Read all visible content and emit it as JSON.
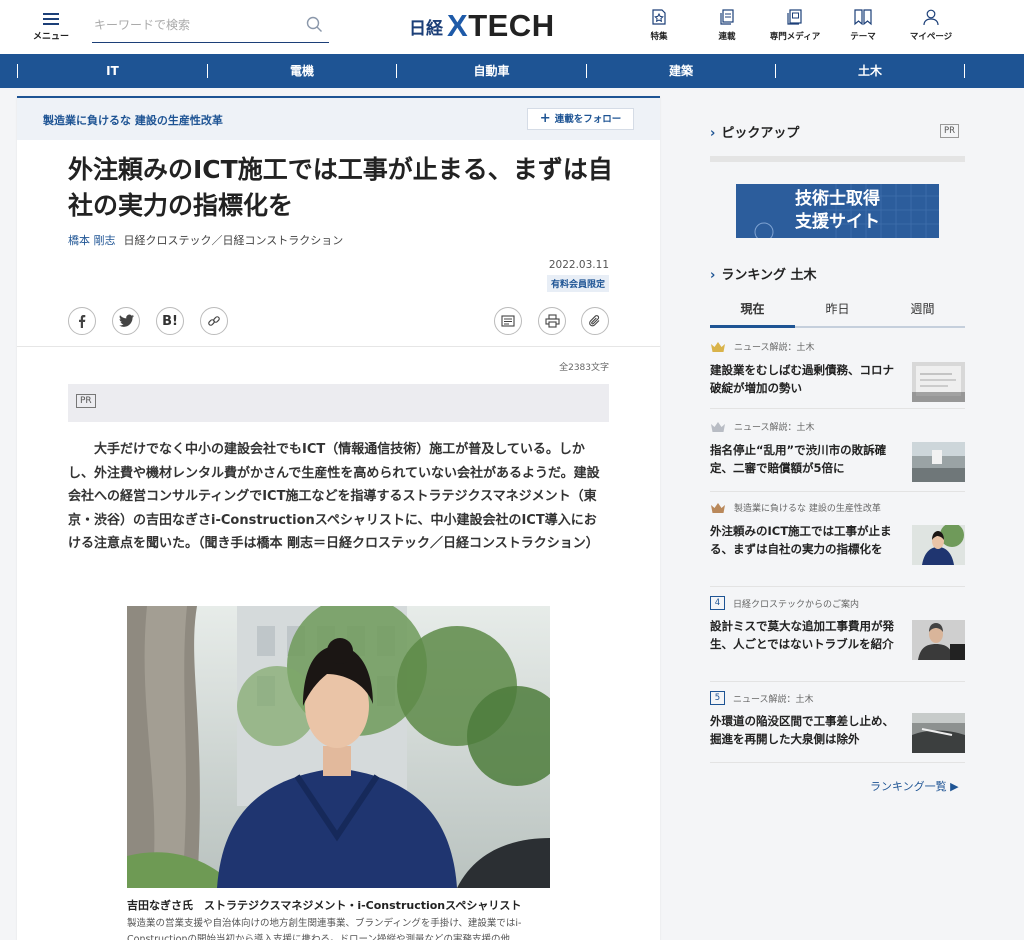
{
  "header": {
    "menu_label": "メニュー",
    "search_placeholder": "キーワードで検索",
    "logo_nikkei": "日経",
    "logo_xtech_x": "X",
    "logo_xtech_rest": "TECH",
    "nav": [
      {
        "label": "特集",
        "icon": "star-document-icon"
      },
      {
        "label": "連載",
        "icon": "stacked-pages-icon"
      },
      {
        "label": "専門メディア",
        "icon": "magazine-icon"
      },
      {
        "label": "テーマ",
        "icon": "bookmark-pair-icon"
      },
      {
        "label": "マイページ",
        "icon": "user-icon"
      }
    ]
  },
  "categories": [
    "IT",
    "電機",
    "自動車",
    "建築",
    "土木"
  ],
  "article": {
    "series_title": "製造業に負けるな 建設の生産性改革",
    "follow_label": "連載をフォロー",
    "headline": "外注頼みのICT施工では工事が止まる、まずは自社の実力の指標化を",
    "author": "橋本 剛志",
    "publication": "日経クロステック／日経コンストラクション",
    "date": "2022.03.11",
    "badge": "有料会員限定",
    "word_count": "全2383文字",
    "pr_label": "PR",
    "lede": "大手だけでなく中小の建設会社でもICT（情報通信技術）施工が普及している。しかし、外注費や機材レンタル費がかさんで生産性を高められていない会社があるようだ。建設会社への経営コンサルティングでICT施工などを指導するストラテジクスマネジメント（東京・渋谷）の吉田なぎさi-Constructionスペシャリストに、中小建設会社のICT導入における注意点を聞いた。（聞き手は橋本 剛志＝日経クロステック／日経コンストラクション）",
    "photo_caption_name": "吉田なぎさ氏　ストラテジクスマネジメント・i-Constructionスペシャリスト",
    "photo_caption_desc": "製造業の営業支援や自治体向けの地方創生関連事業、ブランディングを手掛け、建設業ではi-Constructionの開始当初から導入支援に携わる。ドローン操縦や測量などの実務支援の他"
  },
  "sidebar": {
    "pickup_title": "ピックアップ",
    "pr_label": "PR",
    "banner_line1": "技術士取得",
    "banner_line2": "支援サイト",
    "ranking_title": "ランキング 土木",
    "tabs": [
      "現在",
      "昨日",
      "週間"
    ],
    "ranking": [
      {
        "rank": "1",
        "category": "ニュース解説：土木",
        "title": "建設業をむしばむ過剰債務、コロナ破綻が増加の勢い",
        "crown_color": "#d9b34a"
      },
      {
        "rank": "2",
        "category": "ニュース解説：土木",
        "title": "指名停止“乱用”で渋川市の敗訴確定、二審で賠償額が5倍に",
        "crown_color": "#b8bcc4"
      },
      {
        "rank": "3",
        "category": "製造業に負けるな 建設の生産性改革",
        "title": "外注頼みのICT施工では工事が止まる、まずは自社の実力の指標化を",
        "crown_color": "#b9885a"
      },
      {
        "rank": "4",
        "category": "日経クロステックからのご案内",
        "title": "設計ミスで莫大な追加工事費用が発生、人ごとではないトラブルを紹介"
      },
      {
        "rank": "5",
        "category": "ニュース解説：土木",
        "title": "外環道の陥没区間で工事差し止め、掘進を再開した大泉側は除外"
      }
    ],
    "more_label": "ランキング一覧 ▶"
  }
}
